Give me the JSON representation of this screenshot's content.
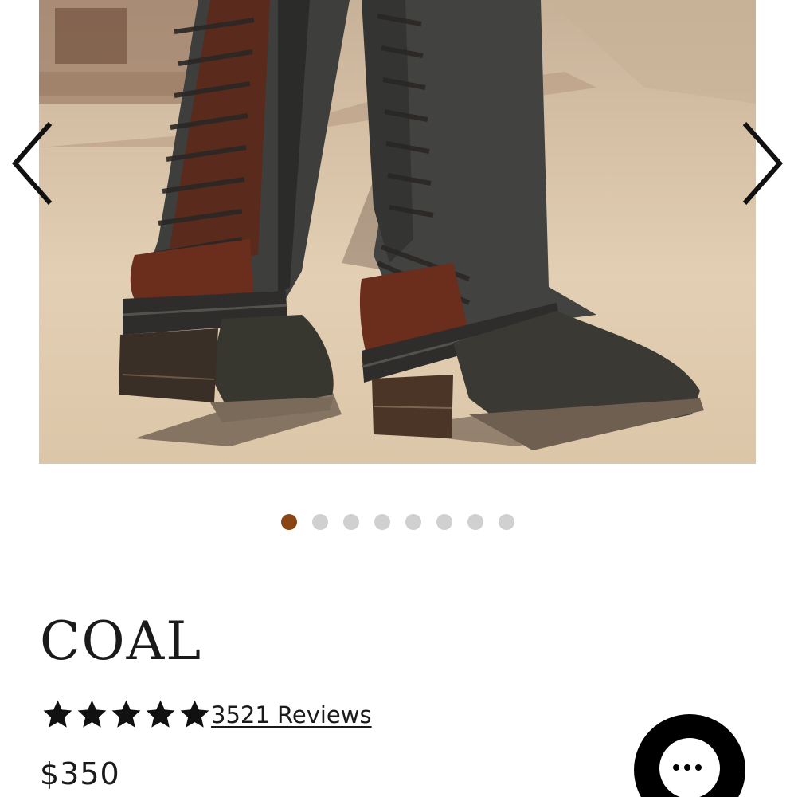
{
  "carousel": {
    "image_alt": "Dark grey leather lace-up tall boots with burgundy suede heel panels on sand",
    "prev_icon": "chevron-left-icon",
    "next_icon": "chevron-right-icon",
    "slide_count": 8,
    "active_index": 0,
    "active_color": "#8a4515",
    "inactive_color": "#d0d0d0"
  },
  "product": {
    "title": "COAL",
    "rating": 5,
    "reviews_label": "3521 Reviews",
    "price": "$350"
  },
  "chat": {
    "icon": "chat-bubble-icon"
  }
}
